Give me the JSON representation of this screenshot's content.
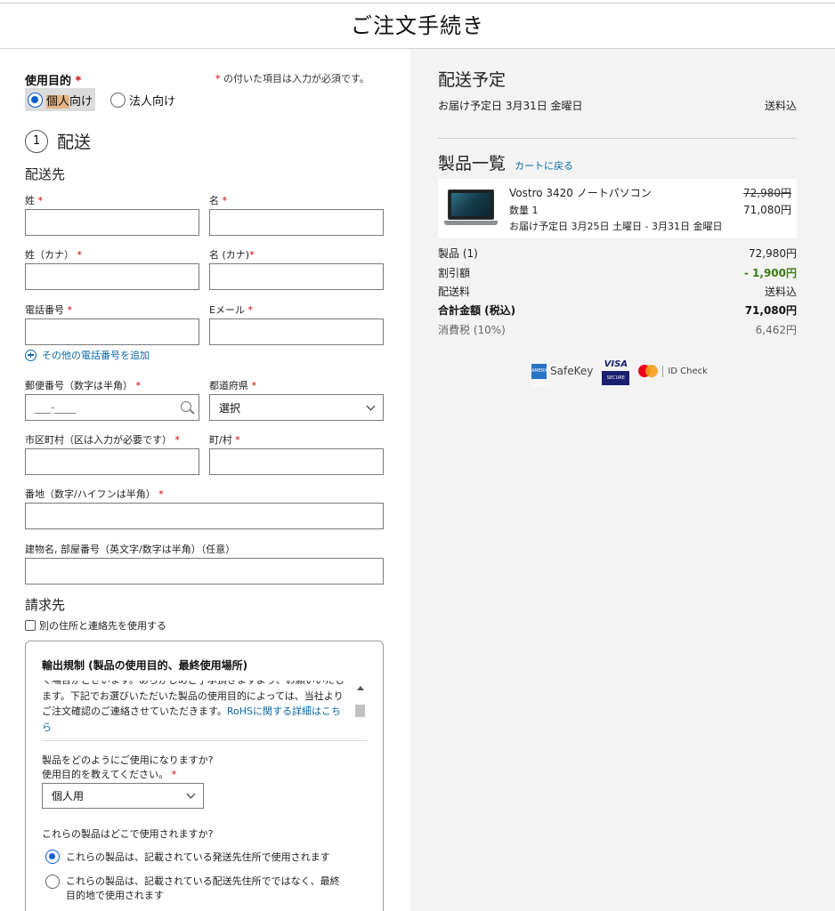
{
  "header": {
    "title": "ご注文手続き"
  },
  "purpose": {
    "title": "使用目的",
    "required_mark": "*",
    "required_note": "の付いた項目は入力が必須です。",
    "options": [
      {
        "label_hl": "個人",
        "label_rest": "向け",
        "selected": true
      },
      {
        "label": "法人向け",
        "selected": false
      }
    ]
  },
  "step": {
    "number": "1",
    "title": "配送"
  },
  "shipping": {
    "section_title": "配送先",
    "fields": {
      "last_name": "姓",
      "first_name": "名",
      "last_kana": "姓（カナ）",
      "first_kana": "名 (カナ)",
      "phone": "電話番号",
      "email": "Eメール",
      "add_phone": "その他の電話番号を追加",
      "zip": "郵便番号（数字は半角）",
      "zip_placeholder": "___-____",
      "prefecture": "都道府県",
      "prefecture_value": "選択",
      "city": "市区町村（区は入力が必要です）",
      "town": "町/村",
      "address": "番地（数字/ハイフンは半角）",
      "building": "建物名, 部屋番号（英文字/数字は半角）（任意）"
    }
  },
  "billing": {
    "section_title": "請求先",
    "checkbox_label": "別の住所と連絡先を使用する"
  },
  "export": {
    "title": "輸出規制 (製品の使用目的、最終使用場所)",
    "scroll_text": "く場合がございます。あらかじめご了承頂きますよう、お願いいたします。下記でお選びいただいた製品の使用目的によっては、当社よりご注文確認のご連絡させていただきます。",
    "link_text": "RoHSに関する詳細はこちら",
    "question1": "製品をどのようにご使用になりますか?　使用目的を教えてください。",
    "use_value": "個人用",
    "question2": "これらの製品はどこで使用されますか?",
    "option1": "これらの製品は、記載されている発送先住所で使用されます",
    "option2": "これらの製品は、記載されている配送先住所でではなく、最終目的地で使用されます"
  },
  "delivery": {
    "title": "配送予定",
    "date_text": "お届け予定日 3月31日 金曜日",
    "shipping_incl": "送料込"
  },
  "products": {
    "title": "製品一覧",
    "back_link": "カートに戻る",
    "items": [
      {
        "name": "Vostro 3420 ノートパソコン",
        "qty": "数量 1",
        "delivery": "お届け予定日 3月25日 土曜日 - 3月31日 金曜日",
        "original_price": "72,980円",
        "price": "71,080円"
      }
    ]
  },
  "summary": {
    "items_label": "製品 (1)",
    "items_value": "72,980円",
    "discount_label": "割引額",
    "discount_value": "- 1,900円",
    "shipping_label": "配送料",
    "shipping_value": "送料込",
    "total_label": "合計金額 (税込)",
    "total_value": "71,080円",
    "tax_label": "消費税 (10%)",
    "tax_value": "6,462円"
  },
  "payments": {
    "amex_label": "SafeKey",
    "amex_icon_text": "AMERICAN EXPRESS",
    "visa_label": "VISA",
    "visa_secure": "SECURE",
    "mc_label": "ID Check"
  },
  "colors": {
    "link": "#0b6aa8",
    "discount": "#3f7a17",
    "required": "#cc0000",
    "radio": "#0b5fd1"
  }
}
